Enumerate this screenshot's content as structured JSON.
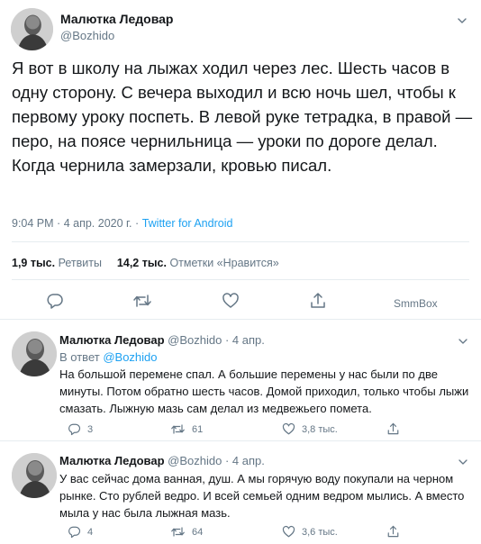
{
  "main_tweet": {
    "author_name": "Малютка Ледовар",
    "author_handle": "@Bozhido",
    "text": "Я вот в школу на лыжах ходил через лес. Шесть часов в одну сторону. С вечера выходил и всю ночь шел, чтобы к первому уроку поспеть. В левой руке тетрадка, в правой — перо, на поясе чернильница — уроки по дороге делал. Когда чернила замерзали, кровью писал.",
    "time": "9:04 PM",
    "date": "4 апр. 2020 г.",
    "separator": "·",
    "source": "Twitter for Android",
    "retweets_count": "1,9 тыс.",
    "retweets_label": "Ретвиты",
    "likes_count": "14,2 тыс.",
    "likes_label": "Отметки «Нравится»",
    "smmbox_label": "SmmBox"
  },
  "replies": [
    {
      "author_name": "Малютка Ледовар",
      "author_handle": "@Bozhido",
      "time": "· 4 апр.",
      "in_reply_prefix": "В ответ",
      "in_reply_handle": "@Bozhido",
      "text": "На большой перемене спал. А большие перемены у нас были по две минуты. Потом обратно шесть часов. Домой приходил, только чтобы лыжи смазать. Лыжную мазь сам делал из медвежьего помета.",
      "reply_count": "3",
      "retweet_count": "61",
      "like_count": "3,8 тыс."
    },
    {
      "author_name": "Малютка Ледовар",
      "author_handle": "@Bozhido",
      "time": "· 4 апр.",
      "text": "У вас сейчас дома ванная, душ. А мы горячую воду покупали на черном рынке. Сто рублей ведро. И всей семьей одним ведром мылись. А вместо мыла у нас была лыжная мазь.",
      "reply_count": "4",
      "retweet_count": "64",
      "like_count": "3,6 тыс."
    }
  ],
  "colors": {
    "text": "#14171a",
    "secondary": "#657786",
    "link": "#1da1f2",
    "border": "#e6ecf0"
  },
  "icons": [
    "chevron-down-icon",
    "reply-icon",
    "retweet-icon",
    "like-icon",
    "share-icon"
  ]
}
